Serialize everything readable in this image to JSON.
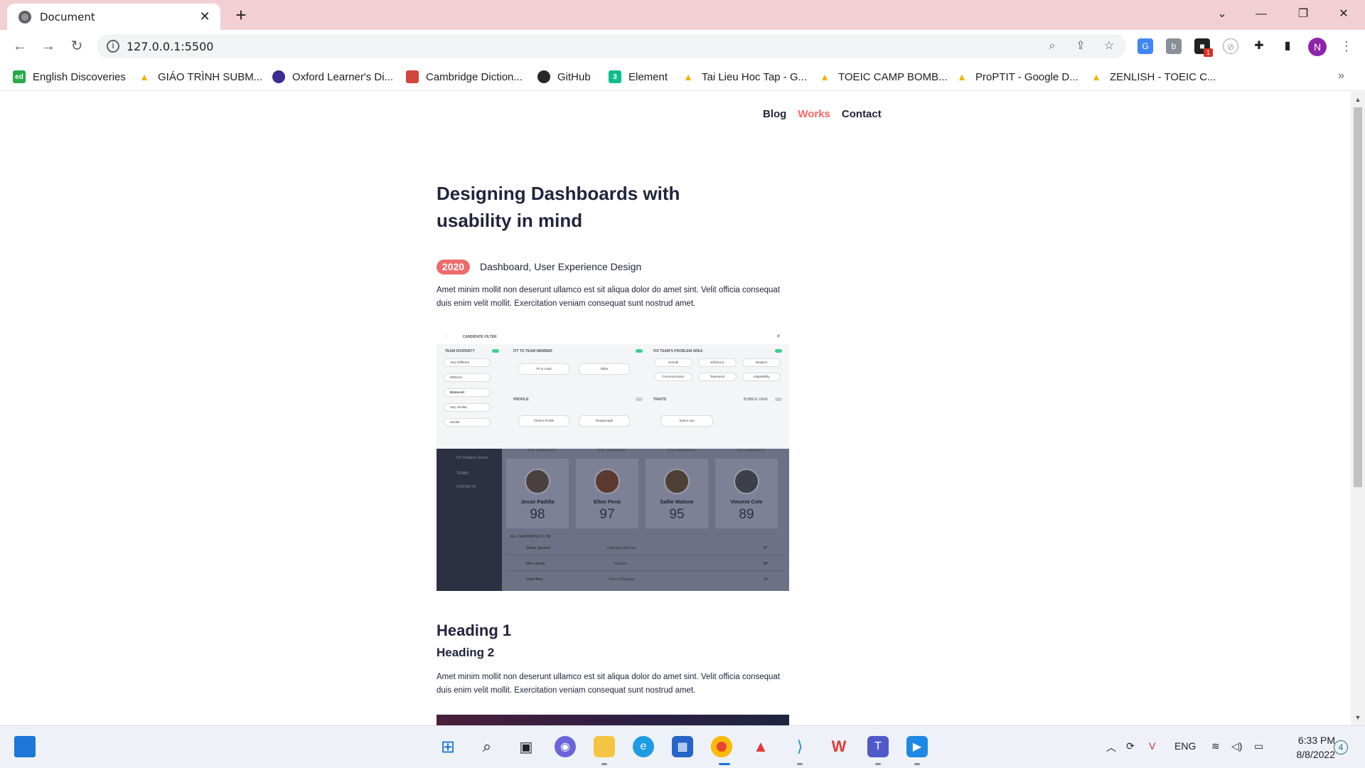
{
  "browser": {
    "tab_title": "Document",
    "url": "127.0.0.1:5500",
    "profile_initial": "N",
    "extension_badge": "1"
  },
  "bookmarks": [
    {
      "label": "English Discoveries",
      "icon": "ed-icon",
      "color": "#2aa84a",
      "glyph": "ed"
    },
    {
      "label": "GIÁO TRÌNH SUBM...",
      "icon": "google-drive-icon",
      "color": "#f4b400",
      "glyph": "▲"
    },
    {
      "label": "Oxford Learner's Di...",
      "icon": "oxford-icon",
      "color": "#3b2c8f",
      "glyph": "●"
    },
    {
      "label": "Cambridge Diction...",
      "icon": "cambridge-icon",
      "color": "#d1453b",
      "glyph": "■"
    },
    {
      "label": "GitHub",
      "icon": "github-icon",
      "color": "#24292e",
      "glyph": "●"
    },
    {
      "label": "Element",
      "icon": "element-icon",
      "color": "#0dbd8b",
      "glyph": "3"
    },
    {
      "label": "Tai Lieu Hoc Tap - G...",
      "icon": "google-drive-icon",
      "color": "#f4b400",
      "glyph": "▲"
    },
    {
      "label": "TOEIC CAMP BOMB...",
      "icon": "google-drive-icon",
      "color": "#f4b400",
      "glyph": "▲"
    },
    {
      "label": "ProPTIT - Google D...",
      "icon": "google-drive-icon",
      "color": "#f4b400",
      "glyph": "▲"
    },
    {
      "label": "ZENLISH - TOEIC C...",
      "icon": "google-drive-icon",
      "color": "#f4b400",
      "glyph": "▲"
    }
  ],
  "site": {
    "nav": [
      "Blog",
      "Works",
      "Contact"
    ],
    "active_nav": "Works",
    "post": {
      "title": "Designing Dashboards with usability in mind",
      "year": "2020",
      "tags": "Dashboard, User Experience Design",
      "intro": "Amet minim mollit non deserunt ullamco est sit aliqua dolor do amet sint. Velit officia consequat duis enim velit mollit. Exercitation veniam consequat sunt nostrud amet.",
      "heading1": "Heading 1",
      "heading2": "Heading 2",
      "body": "Amet minim mollit non deserunt ullamco est sit aliqua dolor do amet sint. Velit officia consequat duis enim velit mollit. Exercitation veniam consequat sunt nostrud amet."
    }
  },
  "dashboard_image": {
    "filter_title": "CANDIDATE FILTER",
    "team_diversity": "TEAM DIVERSITY",
    "diversity_options": [
      "Very Different",
      "Different",
      "Balanced",
      "Very Similar",
      "Similar"
    ],
    "fit_to_team": "FIT TO TEAM MEMBER",
    "fit_select": "Fit to Lead",
    "other_select": "Other",
    "profile": "PROFILE",
    "profile_selects": [
      "Perfect Profile",
      "Readymade"
    ],
    "problem_area": "FIX TEAM'S PROBLEM AREA",
    "problem_chips": [
      "Overall",
      "Efficiency",
      "Respect",
      "Communication",
      "Teamwork",
      "Adaptability"
    ],
    "traits": "TRAITS",
    "bubble_view": "BUBBLE VIEW",
    "traits_select": "Select one",
    "sidebar": [
      "UX Designer Senior",
      "TEAMS",
      "CONTACTS"
    ],
    "top_label": "TOP CANDIDATE",
    "candidates": [
      {
        "name": "Jesse Padilla",
        "score": "98"
      },
      {
        "name": "Ellen Pena",
        "score": "97"
      },
      {
        "name": "Sallie Malone",
        "score": "95"
      },
      {
        "name": "Vincent Cole",
        "score": "89"
      }
    ],
    "all_candidates": "ALL CANDIDATES",
    "all_count": "5 / 89",
    "rows": [
      {
        "name": "Shane Spencer",
        "trait": "Calming Influence",
        "score": "87"
      },
      {
        "name": "Mina Glover",
        "trait": "Nurturer",
        "score": "86"
      },
      {
        "name": "Violet Rios",
        "trait": "Voice of Reason",
        "score": "79"
      }
    ]
  },
  "taskbar": {
    "language": "ENG",
    "time": "6:33 PM",
    "date": "8/8/2022",
    "notifications": "4"
  },
  "colors": {
    "accent": "#ff6464",
    "badge": "#ee6b6b",
    "text": "#21243d",
    "titlebar": "#f2cfd2"
  }
}
